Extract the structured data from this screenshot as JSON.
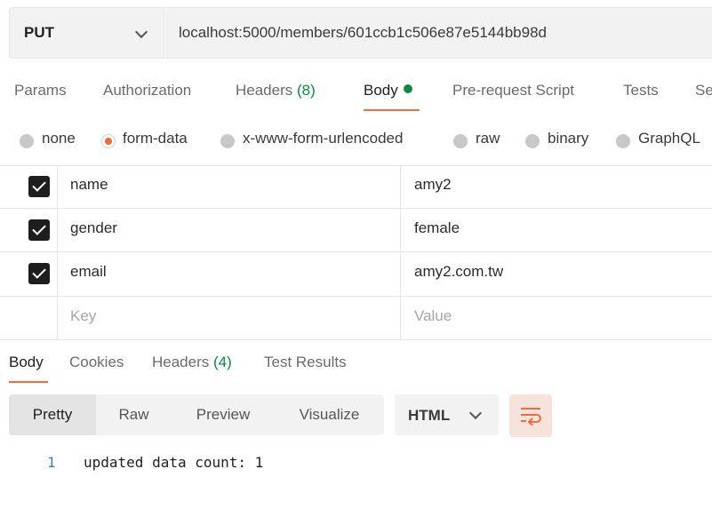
{
  "request": {
    "method": "PUT",
    "url": "localhost:5000/members/601ccb1c506e87e5144bb98d"
  },
  "request_tabs": [
    {
      "label": "Params"
    },
    {
      "label": "Authorization"
    },
    {
      "label": "Headers",
      "count": "(8)"
    },
    {
      "label": "Body",
      "active": true
    },
    {
      "label": "Pre-request Script"
    },
    {
      "label": "Tests"
    },
    {
      "label": "Se"
    }
  ],
  "body_types": [
    {
      "label": "none",
      "selected": false
    },
    {
      "label": "form-data",
      "selected": true
    },
    {
      "label": "x-www-form-urlencoded",
      "selected": false
    },
    {
      "label": "raw",
      "selected": false
    },
    {
      "label": "binary",
      "selected": false
    },
    {
      "label": "GraphQL",
      "selected": false
    }
  ],
  "form_rows": [
    {
      "checked": true,
      "key": "name",
      "value": "amy2"
    },
    {
      "checked": true,
      "key": "gender",
      "value": "female"
    },
    {
      "checked": true,
      "key": "email",
      "value": "amy2.com.tw"
    }
  ],
  "placeholders": {
    "key": "Key",
    "value": "Value"
  },
  "response_tabs": [
    {
      "label": "Body",
      "active": true
    },
    {
      "label": "Cookies"
    },
    {
      "label": "Headers",
      "count": "(4)"
    },
    {
      "label": "Test Results"
    }
  ],
  "view_modes": [
    "Pretty",
    "Raw",
    "Preview",
    "Visualize"
  ],
  "active_view_mode": "Pretty",
  "format": "HTML",
  "wrap_icon": "wrap-lines-icon",
  "output": [
    {
      "line": "1",
      "text": "updated data count: 1"
    }
  ],
  "colors": {
    "accent": "#f26b3a",
    "count_green": "#0c8a3e"
  }
}
